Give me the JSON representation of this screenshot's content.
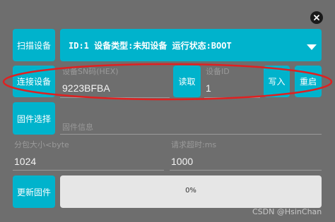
{
  "dialog": {
    "close_icon": "close-icon"
  },
  "toolbar": {
    "scan_label": "扫描设备",
    "connect_label": "连接设备",
    "firmware_select_label": "固件选择",
    "update_firmware_label": "更新固件",
    "read_label": "读取",
    "write_label": "写入",
    "restart_label": "重启"
  },
  "device_selector": {
    "selected": "ID:1  设备类型:未知设备  运行状态:BOOT",
    "arrow_icon": "dropdown-arrow-icon"
  },
  "fields": {
    "sn_label": "设备SN码(HEX)",
    "sn_value": "9223BFBA",
    "device_id_label": "设备ID",
    "device_id_value": "1",
    "firmware_info_label": "固件信息",
    "firmware_info_value": "",
    "packet_size_label": "分包大小<byte",
    "packet_size_value": "1024",
    "timeout_label": "请求超时:ms",
    "timeout_value": "1000"
  },
  "progress": {
    "percent": 0,
    "label": "0%"
  },
  "annotation": {
    "color": "#e02020"
  },
  "watermark": "CSDN @HsinChan",
  "colors": {
    "accent": "#00b3cc",
    "background": "#6e6e6e",
    "progress_track": "#e6e6e6"
  }
}
